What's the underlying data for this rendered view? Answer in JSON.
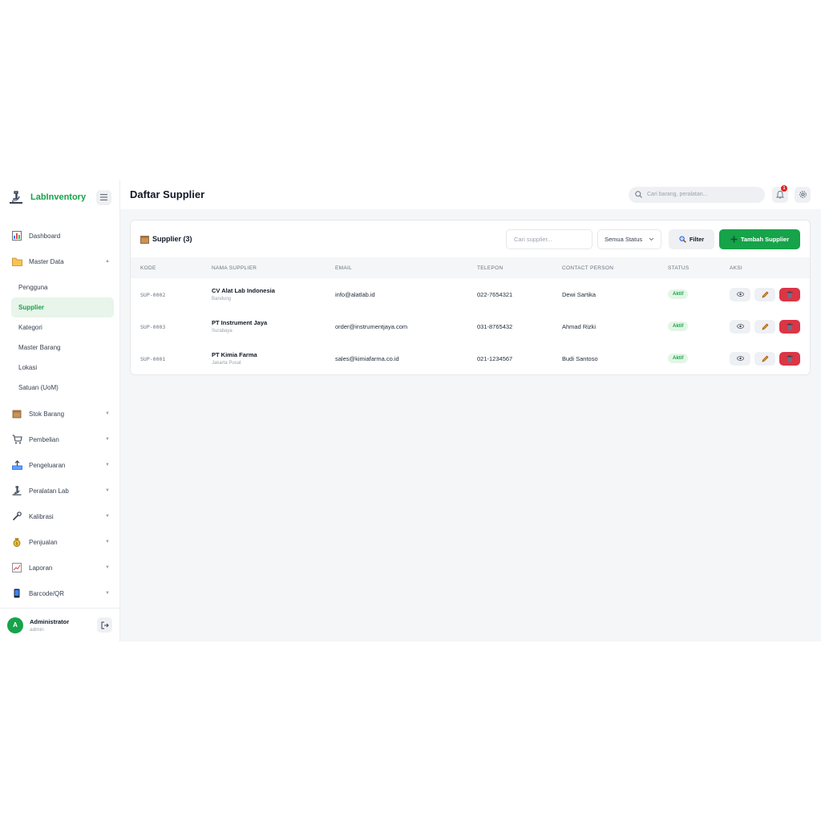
{
  "brand": {
    "name": "LabInventory"
  },
  "sidebar": {
    "items": [
      {
        "label": "Dashboard",
        "icon": "chart-icon"
      },
      {
        "label": "Master Data",
        "icon": "folder-icon",
        "expanded": true,
        "children": [
          {
            "label": "Pengguna",
            "active": false
          },
          {
            "label": "Supplier",
            "active": true
          },
          {
            "label": "Kategori",
            "active": false
          },
          {
            "label": "Master Barang",
            "active": false
          },
          {
            "label": "Lokasi",
            "active": false
          },
          {
            "label": "Satuan (UoM)",
            "active": false
          }
        ]
      },
      {
        "label": "Stok Barang",
        "icon": "box-icon"
      },
      {
        "label": "Pembelian",
        "icon": "cart-icon"
      },
      {
        "label": "Pengeluaran",
        "icon": "outbox-icon"
      },
      {
        "label": "Peralatan Lab",
        "icon": "microscope-icon"
      },
      {
        "label": "Kalibrasi",
        "icon": "wrench-icon"
      },
      {
        "label": "Penjualan",
        "icon": "money-bag-icon"
      },
      {
        "label": "Laporan",
        "icon": "report-icon"
      },
      {
        "label": "Barcode/QR",
        "icon": "phone-icon"
      }
    ]
  },
  "user": {
    "initial": "A",
    "name": "Administrator",
    "role": "admin"
  },
  "header": {
    "title": "Daftar Supplier",
    "search_placeholder": "Cari barang, peralatan...",
    "notification_count": "1"
  },
  "card": {
    "title": "Supplier (3)",
    "search_placeholder": "Cari supplier...",
    "status_filter": "Semua Status",
    "filter_label": "Filter",
    "add_label": "Tambah Supplier"
  },
  "table": {
    "headers": [
      "KODE",
      "NAMA SUPPLIER",
      "EMAIL",
      "TELEPON",
      "CONTACT PERSON",
      "STATUS",
      "AKSI"
    ],
    "rows": [
      {
        "kode": "SUP-0002",
        "nama": "CV Alat Lab Indonesia",
        "kota": "Bandung",
        "email": "info@alatlab.id",
        "telepon": "022-7654321",
        "contact": "Dewi Sartika",
        "status": "Aktif"
      },
      {
        "kode": "SUP-0003",
        "nama": "PT Instrument Jaya",
        "kota": "Surabaya",
        "email": "order@instrumentjaya.com",
        "telepon": "031-8765432",
        "contact": "Ahmad Rizki",
        "status": "Aktif"
      },
      {
        "kode": "SUP-0001",
        "nama": "PT Kimia Farma",
        "kota": "Jakarta Pusat",
        "email": "sales@kimiafarma.co.id",
        "telepon": "021-1234567",
        "contact": "Budi Santoso",
        "status": "Aktif"
      }
    ]
  },
  "colors": {
    "accent": "#16a34a",
    "danger": "#dc3545",
    "status_bg": "#e3f6e6"
  }
}
